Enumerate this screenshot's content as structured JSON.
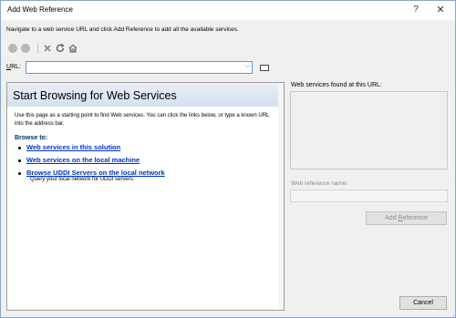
{
  "window": {
    "title": "Add Web Reference",
    "help_glyph": "?",
    "close_glyph": "✕"
  },
  "instruction": "Navigate to a web service URL and click Add Reference to add all the available services.",
  "toolbar": {
    "icons": [
      "back-icon",
      "forward-icon",
      "stop-icon",
      "refresh-icon",
      "home-icon"
    ]
  },
  "url": {
    "label_prefix": "",
    "label_access": "U",
    "label_rest": "RL:",
    "value": "",
    "dropdown_glyph": "⌵"
  },
  "browser": {
    "heading": "Start Browsing for Web Services",
    "description": "Use this page as a starting point to find Web services. You can click the links below, or type a known URL into the address bar.",
    "browse_to": "Browse to:",
    "links": [
      {
        "label": "Web services in this solution",
        "sub": ""
      },
      {
        "label": "Web services on the local machine",
        "sub": ""
      },
      {
        "label": "Browse UDDI Servers on the local network",
        "sub": "Query your local network for UDDI servers."
      }
    ]
  },
  "right_panel": {
    "found_label": "Web services found at this URL:",
    "refname_label": "Web reference name:",
    "refname_value": "",
    "add_button_prefix": "Add ",
    "add_button_access": "R",
    "add_button_rest": "eference"
  },
  "footer": {
    "cancel_label": "Cancel"
  },
  "colors": {
    "link": "#0033cc",
    "focus_border": "#5b9bd5",
    "banner_top": "#e9eff7",
    "banner_bottom": "#d6e0ee"
  }
}
